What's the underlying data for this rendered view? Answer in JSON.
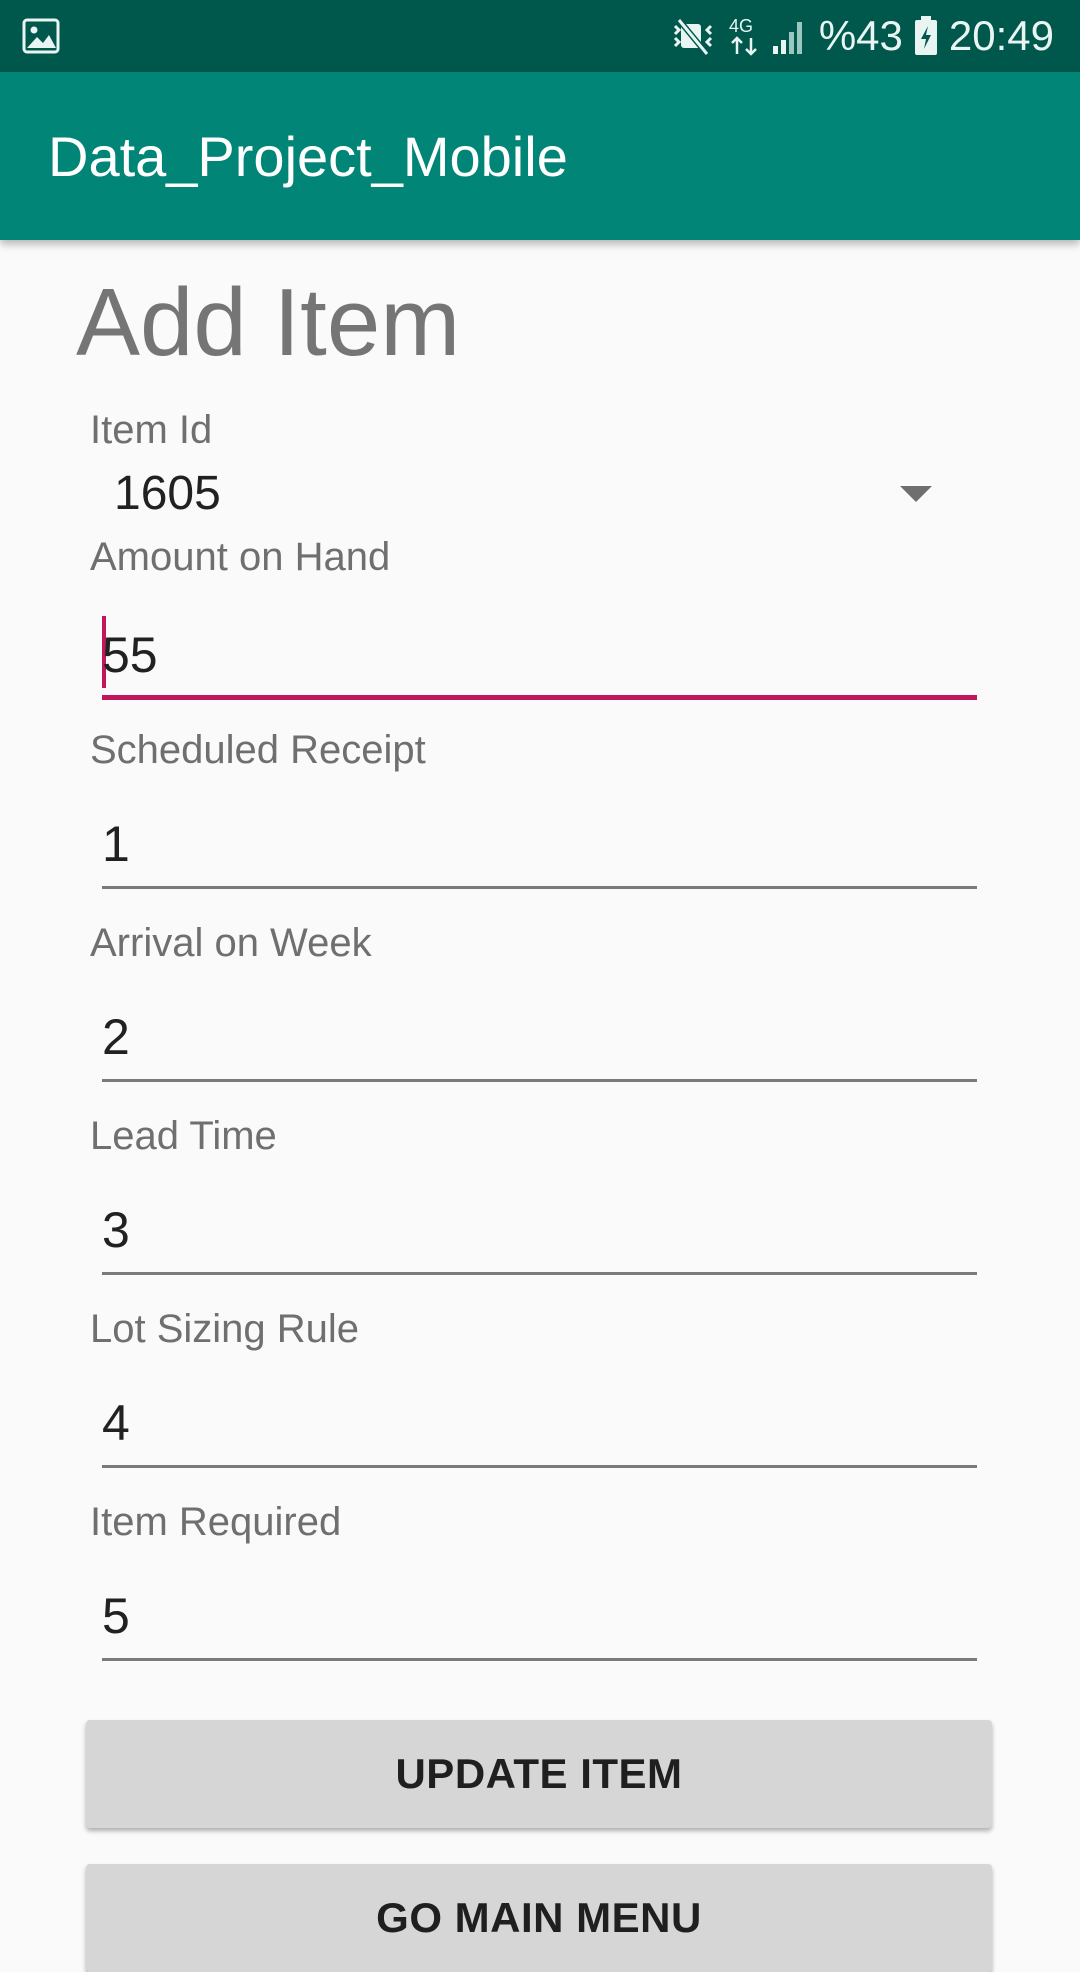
{
  "status_bar": {
    "battery_text": "%43",
    "time": "20:49",
    "network_label": "4G",
    "icons": [
      "gallery-icon",
      "mute-icon",
      "network-4g-icon",
      "signal-icon",
      "battery-charging-icon"
    ]
  },
  "app_bar": {
    "title": "Data_Project_Mobile",
    "color": "#008577"
  },
  "page": {
    "title": "Add Item",
    "item_id": {
      "label": "Item Id",
      "value": "1605"
    },
    "fields": [
      {
        "label": "Amount on Hand",
        "value": "55",
        "focused": true
      },
      {
        "label": "Scheduled Receipt",
        "value": "1"
      },
      {
        "label": "Arrival on Week",
        "value": "2"
      },
      {
        "label": "Lead Time",
        "value": "3"
      },
      {
        "label": "Lot Sizing Rule",
        "value": "4"
      },
      {
        "label": "Item Required",
        "value": "5"
      }
    ],
    "buttons": {
      "update": "UPDATE ITEM",
      "main_menu": "GO MAIN MENU"
    }
  },
  "colors": {
    "accent": "#c2185b",
    "status_bar": "#00574b"
  }
}
